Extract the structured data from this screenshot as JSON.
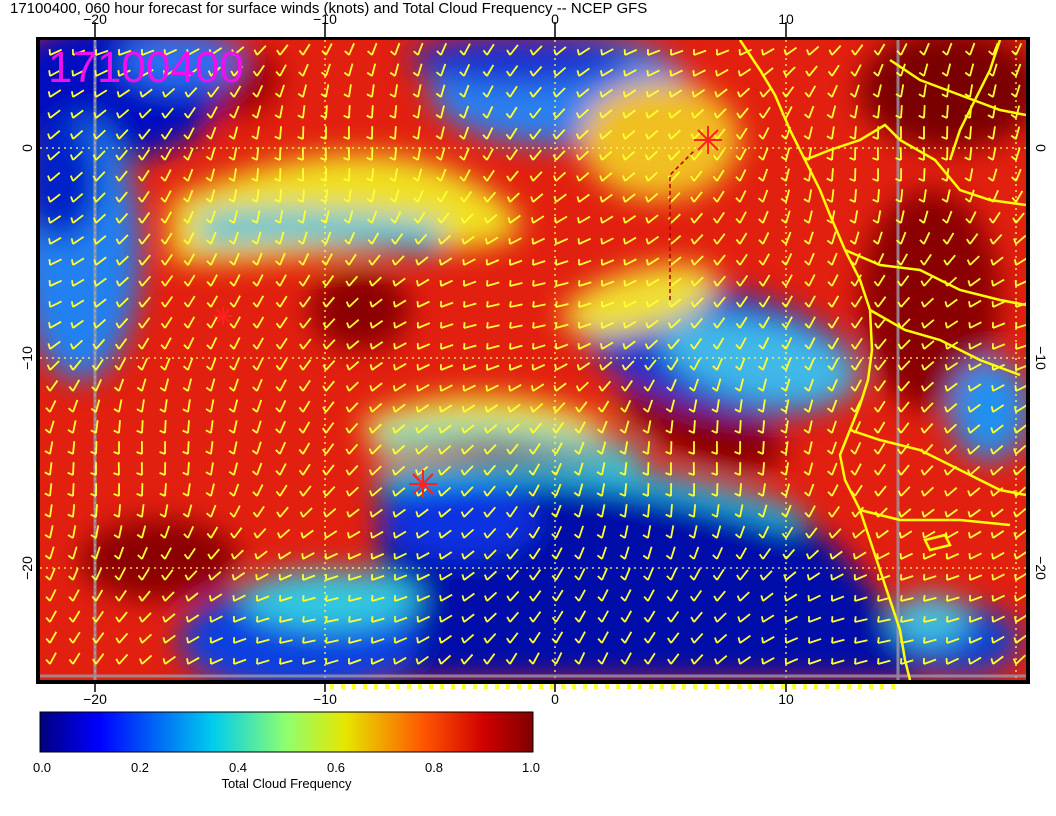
{
  "title": "17100400, 060 hour forecast for surface winds (knots) and Total Cloud Frequency -- NCEP GFS",
  "stamp": "17100400",
  "axes": {
    "x_ticks": [
      "−20",
      "−10",
      "0",
      "10"
    ],
    "y_ticks": [
      "0",
      "−10",
      "−20"
    ]
  },
  "colorbar": {
    "label": "Total Cloud Frequency",
    "ticks": [
      "0.0",
      "0.2",
      "0.4",
      "0.6",
      "0.8",
      "1.0"
    ],
    "colors": [
      "#00007f",
      "#0000ff",
      "#00bfff",
      "#3fffbf",
      "#bfff3f",
      "#ffbf00",
      "#ff3f00",
      "#7f0000"
    ]
  },
  "overlay_colors": {
    "wind_barbs": "#ffff33",
    "coastline": "#ffff00",
    "gridlines": "#ffff66",
    "markers": "#ff2020"
  }
}
